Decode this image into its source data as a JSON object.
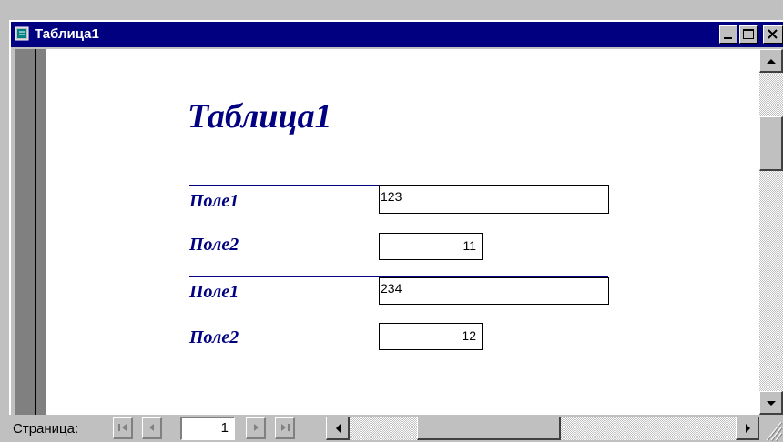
{
  "window": {
    "title": "Таблица1"
  },
  "report": {
    "title": "Таблица1",
    "records": [
      {
        "field1_label": "Поле1",
        "field1_value": "123",
        "field2_label": "Поле2",
        "field2_value": "11"
      },
      {
        "field1_label": "Поле1",
        "field1_value": "234",
        "field2_label": "Поле2",
        "field2_value": "12"
      }
    ]
  },
  "navigation": {
    "page_label": "Страница:",
    "page_number": "1",
    "first_icon": "first-record-icon",
    "prev_icon": "previous-record-icon",
    "next_icon": "next-record-icon",
    "last_icon": "last-record-icon"
  },
  "colors": {
    "title_bar": "#000080",
    "report_text": "#000080",
    "chrome": "#c0c0c0"
  }
}
